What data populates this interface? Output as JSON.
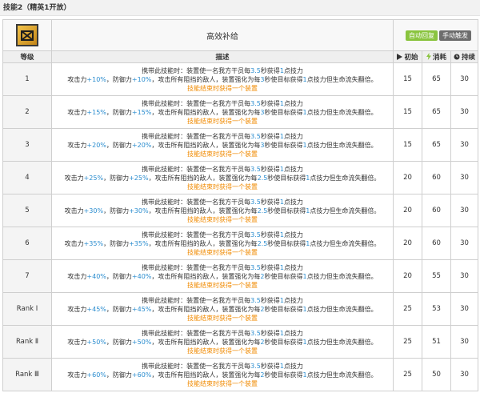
{
  "section_title": "技能2（精英1开放）",
  "skill": {
    "name": "高效补给",
    "icon": "skill-icon-supply",
    "tags": [
      "自动回复",
      "手动触发"
    ]
  },
  "headers": {
    "level": "等级",
    "description": "描述",
    "initial": "初始",
    "cost": "消耗",
    "duration": "持续"
  },
  "rows": [
    {
      "level": "1",
      "atk": "+10%",
      "def": "+10%",
      "interval": "3",
      "initial": "15",
      "cost": "65",
      "duration": "30"
    },
    {
      "level": "2",
      "atk": "+15%",
      "def": "+15%",
      "interval": "3",
      "initial": "15",
      "cost": "65",
      "duration": "30"
    },
    {
      "level": "3",
      "atk": "+20%",
      "def": "+20%",
      "interval": "3",
      "initial": "15",
      "cost": "65",
      "duration": "30"
    },
    {
      "level": "4",
      "atk": "+25%",
      "def": "+25%",
      "interval": "2.5",
      "initial": "20",
      "cost": "60",
      "duration": "30"
    },
    {
      "level": "5",
      "atk": "+30%",
      "def": "+30%",
      "interval": "2.5",
      "initial": "20",
      "cost": "60",
      "duration": "30"
    },
    {
      "level": "6",
      "atk": "+35%",
      "def": "+35%",
      "interval": "2.5",
      "initial": "20",
      "cost": "60",
      "duration": "30"
    },
    {
      "level": "7",
      "atk": "+40%",
      "def": "+40%",
      "interval": "2",
      "initial": "20",
      "cost": "55",
      "duration": "30"
    },
    {
      "level": "Rank Ⅰ",
      "atk": "+45%",
      "def": "+45%",
      "interval": "2",
      "initial": "25",
      "cost": "53",
      "duration": "30"
    },
    {
      "level": "Rank Ⅱ",
      "atk": "+50%",
      "def": "+50%",
      "interval": "2",
      "initial": "25",
      "cost": "51",
      "duration": "30"
    },
    {
      "level": "Rank Ⅲ",
      "atk": "+60%",
      "def": "+60%",
      "interval": "2",
      "initial": "25",
      "cost": "50",
      "duration": "30"
    }
  ],
  "desc_text": {
    "l1a": "携带此技能时：装置使一名我方干员每",
    "l1_num": "3.5",
    "l1b": "秒获得",
    "l1_sp": "1",
    "l1c": "点技力",
    "l2a": "攻击力",
    "l2b": "，防御力",
    "l2c": "，攻击所有阻挡的敌人，装置强化为每",
    "l2d": "秒使目标获得",
    "l2_sp": "1",
    "l2e": "点技力但生命流失翻倍。",
    "l3": "技能结束时获得一个装置"
  },
  "colors": {
    "highlight_blue": "#2b8dcf",
    "highlight_orange": "#f08a00",
    "tag_auto": "#8ac43f",
    "tag_manual": "#6d6d6d"
  }
}
